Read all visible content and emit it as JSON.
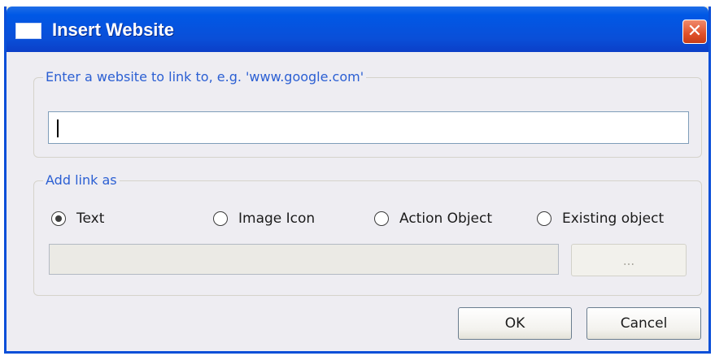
{
  "window": {
    "title": "Insert Website",
    "close_glyph": "✕"
  },
  "website_group": {
    "legend": "Enter a website to link to, e.g. 'www.google.com'",
    "input_value": ""
  },
  "link_group": {
    "legend": "Add link as",
    "options": [
      {
        "label": "Text",
        "checked": true
      },
      {
        "label": "Image Icon",
        "checked": false
      },
      {
        "label": "Action Object",
        "checked": false
      },
      {
        "label": "Existing object",
        "checked": false
      }
    ],
    "path_value": "",
    "browse_label": "..."
  },
  "buttons": {
    "ok_label": "OK",
    "cancel_label": "Cancel"
  },
  "colors": {
    "titlebar": "#0a4fd8",
    "legend_text": "#2b5fd3",
    "close_button": "#e0502a"
  }
}
